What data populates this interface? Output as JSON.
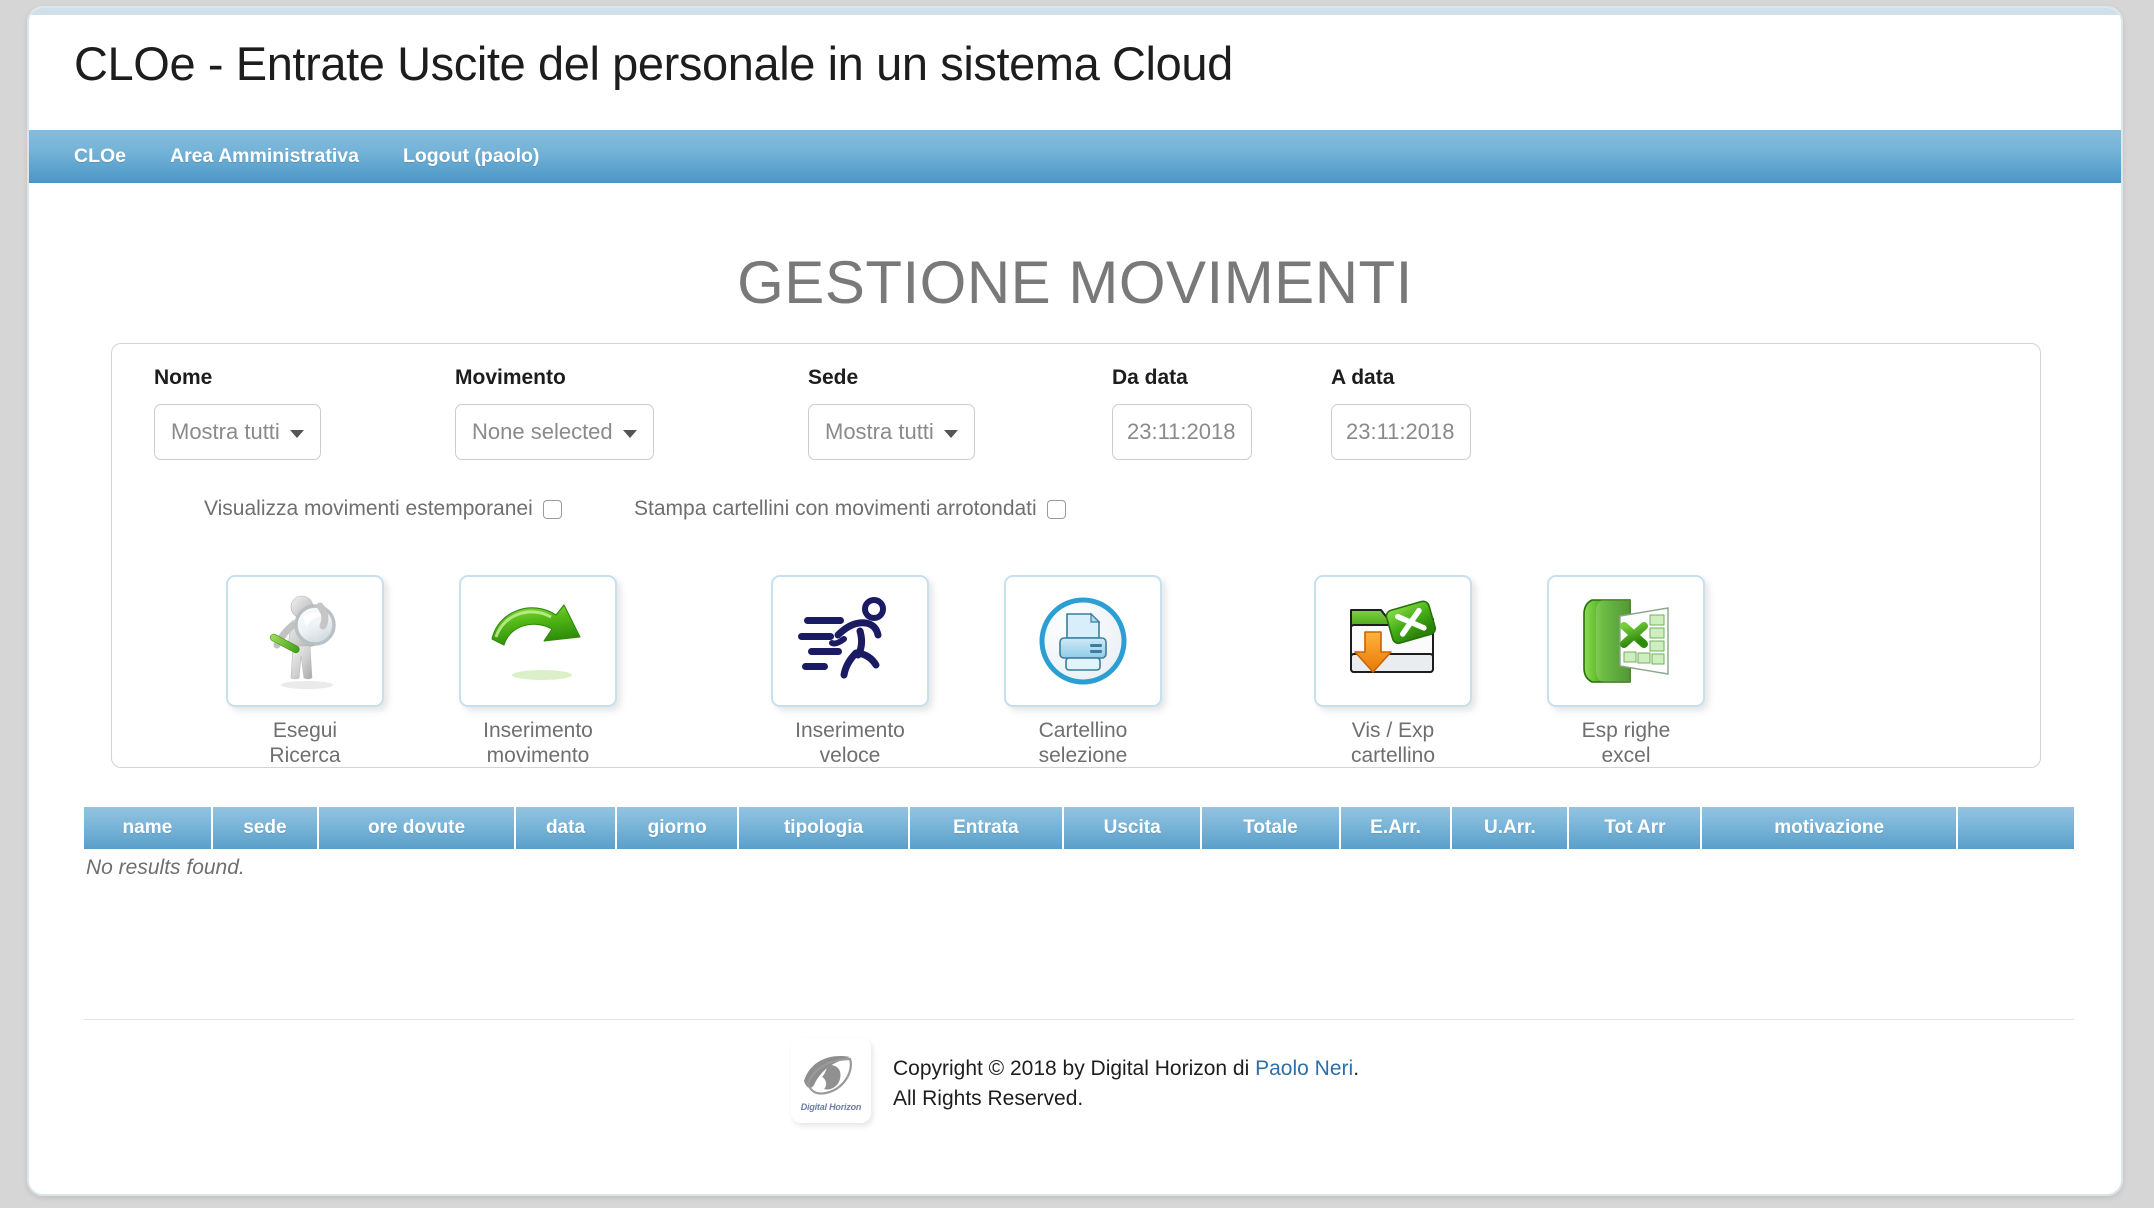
{
  "app": {
    "title": "CLOe - Entrate Uscite del personale in un sistema Cloud"
  },
  "nav": {
    "items": [
      {
        "label": "CLOe",
        "name": "nav-item-cloe"
      },
      {
        "label": "Area Amministrativa",
        "name": "nav-item-area-amministrativa"
      },
      {
        "label": "Logout (paolo)",
        "name": "nav-item-logout"
      }
    ]
  },
  "page": {
    "heading": "GESTIONE MOVIMENTI"
  },
  "filters": {
    "nome": {
      "label": "Nome",
      "value": "Mostra tutti"
    },
    "movimento": {
      "label": "Movimento",
      "value": "None selected"
    },
    "sede": {
      "label": "Sede",
      "value": "Mostra tutti"
    },
    "da_data": {
      "label": "Da data",
      "value": "23:11:2018",
      "placeholder": "23:11:2018"
    },
    "a_data": {
      "label": "A data",
      "value": "23:11:2018",
      "placeholder": "23:11:2018"
    },
    "checkboxes": [
      {
        "label": "Visualizza movimenti estemporanei",
        "checked": false
      },
      {
        "label": "Stampa cartellini con movimenti arrotondati",
        "checked": false
      }
    ]
  },
  "actions": [
    {
      "icon": "person-magnifier-icon",
      "line1": "Esegui",
      "line2": "Ricerca"
    },
    {
      "icon": "green-arrow-icon",
      "line1": "Inserimento",
      "line2": "movimento"
    },
    {
      "icon": "running-man-icon",
      "line1": "Inserimento",
      "line2": "veloce"
    },
    {
      "icon": "printer-circle-icon",
      "line1": "Cartellino",
      "line2": "selezione"
    },
    {
      "icon": "excel-folder-download-icon",
      "line1": "Vis / Exp",
      "line2": "cartellino"
    },
    {
      "icon": "excel-sheet-icon",
      "line1": "Esp righe",
      "line2": "excel"
    }
  ],
  "table": {
    "columns": [
      "name",
      "sede",
      "ore dovute",
      "data",
      "giorno",
      "tipologia",
      "Entrata",
      "Uscita",
      "Totale",
      "E.Arr.",
      "U.Arr.",
      "Tot Arr",
      "motivazione",
      ""
    ],
    "rows": [],
    "empty_message": "No results found."
  },
  "footer": {
    "logo_name": "Digital Horizon",
    "line1_prefix": "Copyright © 2018 by Digital Horizon di ",
    "link": "Paolo Neri",
    "line1_suffix": ".",
    "line2": "All Rights Reserved."
  },
  "colors": {
    "nav_light": "#84bcdd",
    "nav_dark": "#4a96c6",
    "table_header_light": "#93c4e0",
    "table_header_dark": "#5a9fca",
    "tile_border": "#c6e0ef",
    "link": "#2f6fa8",
    "heading": "#797979"
  }
}
